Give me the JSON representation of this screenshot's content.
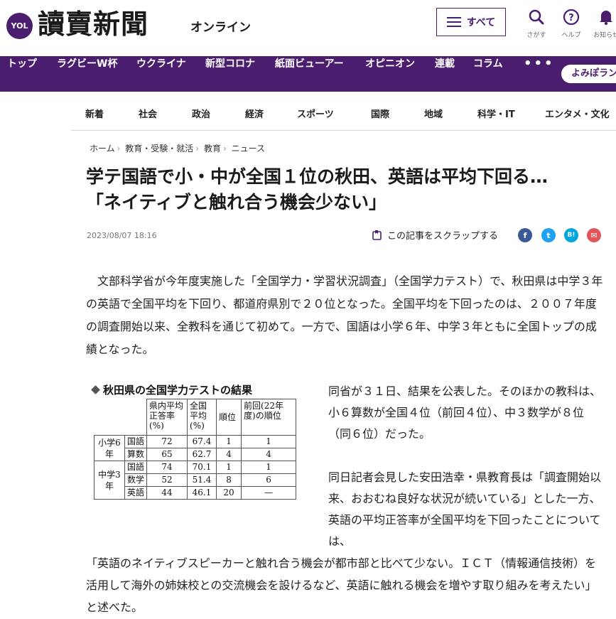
{
  "header": {
    "logo_badge": "YOL",
    "logo_text": "讀賣新聞",
    "logo_sub": "オンライン",
    "all_button": "すべて",
    "tools": [
      {
        "label": "さがす",
        "icon": "search-icon"
      },
      {
        "label": "ヘルプ",
        "icon": "help-icon"
      },
      {
        "label": "お知らせ",
        "icon": "bell-icon"
      }
    ]
  },
  "main_nav": {
    "items": [
      "トップ",
      "ラグビーW杯",
      "ウクライナ",
      "新型コロナ",
      "紙面ビューアー",
      "オピニオン",
      "連載",
      "コラム"
    ],
    "more": "•••",
    "yomiplus": "よみぽラン"
  },
  "sub_nav": {
    "items": [
      "新着",
      "社会",
      "政治",
      "経済",
      "スポーツ",
      "国際",
      "地域",
      "科学・IT",
      "エンタメ・文化"
    ]
  },
  "breadcrumb": [
    "ホーム",
    "教育・受験・就活",
    "教育",
    "ニュース"
  ],
  "article": {
    "title_line1": "学テ国語で小・中が全国１位の秋田、英語は平均下回る…",
    "title_line2": "「ネイティブと触れ合う機会少ない」",
    "date": "2023/08/07 18:16",
    "scrap_label": "この記事をスクラップする",
    "share": [
      {
        "name": "facebook",
        "glyph": "f",
        "color": "#3b5998"
      },
      {
        "name": "twitter",
        "glyph": "t",
        "color": "#1da1f2"
      },
      {
        "name": "hatena",
        "glyph": "B!",
        "color": "#00a4de"
      },
      {
        "name": "mail",
        "glyph": "✉",
        "color": "#e0565b"
      }
    ],
    "paragraph1": "文部科学省が今年度実施した「全国学力・学習状況調査」（全国学力テスト）で、秋田県は中学３年の英語で全国平均を下回り、都道府県別で２０位となった。全国平均を下回ったのは、２００７年度の調査開始以来、全教科を通じて初めて。一方で、国語は小学６年、中学３年ともに全国トップの成績となった。",
    "paragraph2": "同省が３１日、結果を公表した。そのほかの教科は、小６算数が全国４位（前回４位）、中３数学が８位（同６位）だった。",
    "paragraph3": "同日記者会見した安田浩幸・県教育長は「調査開始以来、おおむね良好な状況が続いている」とした一方、英語の平均正答率が全国平均を下回ったことについては、",
    "paragraph4": "「英語のネイティブスピーカーと触れ合う機会が都市部と比べて少ない。ＩＣＴ（情報通信技術）を活用して海外の姉妹校との交流機会を設けるなど、英語に触れる機会を増やす取り組みを考えたい」と述べた。"
  },
  "figure": {
    "title": "秋田県の全国学力テストの結果",
    "headers": [
      "県内平均正答率(%)",
      "全国平均(%)",
      "順位",
      "前回(22年度)の順位"
    ],
    "groups": [
      {
        "name": "小学6年",
        "rows": [
          {
            "subject": "国語",
            "pref": "72",
            "national": "67.4",
            "rank": "1",
            "prev": "1"
          },
          {
            "subject": "算数",
            "pref": "65",
            "national": "62.7",
            "rank": "4",
            "prev": "4"
          }
        ]
      },
      {
        "name": "中学3年",
        "rows": [
          {
            "subject": "国語",
            "pref": "74",
            "national": "70.1",
            "rank": "1",
            "prev": "1"
          },
          {
            "subject": "数学",
            "pref": "52",
            "national": "51.4",
            "rank": "8",
            "prev": "6"
          },
          {
            "subject": "英語",
            "pref": "44",
            "national": "46.1",
            "rank": "20",
            "prev": "—"
          }
        ]
      }
    ]
  },
  "colors": {
    "brand": "#4b1d6e"
  }
}
